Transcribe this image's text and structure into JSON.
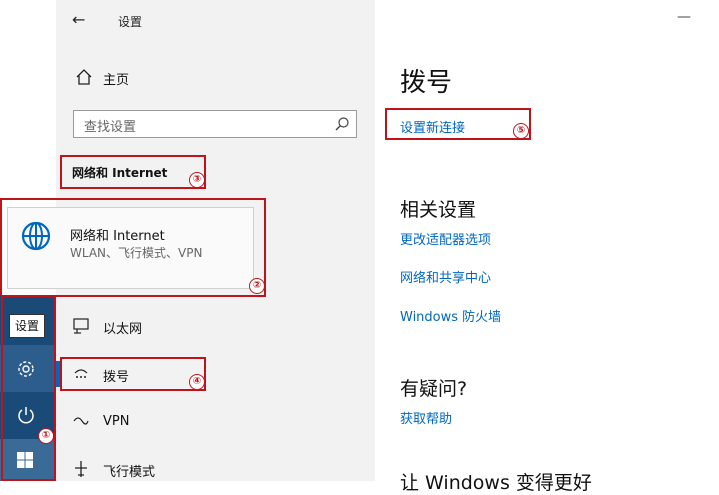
{
  "window": {
    "title": "设置",
    "back_glyph": "←",
    "minimize_glyph": "—"
  },
  "sidebar": {
    "home_label": "主页",
    "search_placeholder": "查找设置",
    "section_title": "网络和 Internet",
    "items": [
      {
        "label": "以太网",
        "icon": "ethernet-icon"
      },
      {
        "label": "拨号",
        "icon": "dial-up-icon",
        "selected": true
      },
      {
        "label": "VPN",
        "icon": "vpn-icon"
      },
      {
        "label": "飞行模式",
        "icon": "airplane-icon"
      }
    ]
  },
  "start_menu": {
    "settings_tooltip": "设置",
    "tile": {
      "title": "网络和 Internet",
      "subtitle": "WLAN、飞行模式、VPN",
      "icon": "globe-icon"
    }
  },
  "main": {
    "title": "拨号",
    "setup_link": "设置新连接",
    "related_heading": "相关设置",
    "related_links": [
      "更改适配器选项",
      "网络和共享中心",
      "Windows 防火墙"
    ],
    "help_heading": "有疑问?",
    "help_link": "获取帮助",
    "bottom_text": "让 Windows 变得更好"
  },
  "annotations": [
    "①",
    "②",
    "③",
    "④",
    "⑤"
  ],
  "colors": {
    "annotation_red": "#c0141c",
    "link_blue": "#0067c0",
    "start_blue": "#1a4a78",
    "sidebar_bg": "#f2f2f2"
  }
}
